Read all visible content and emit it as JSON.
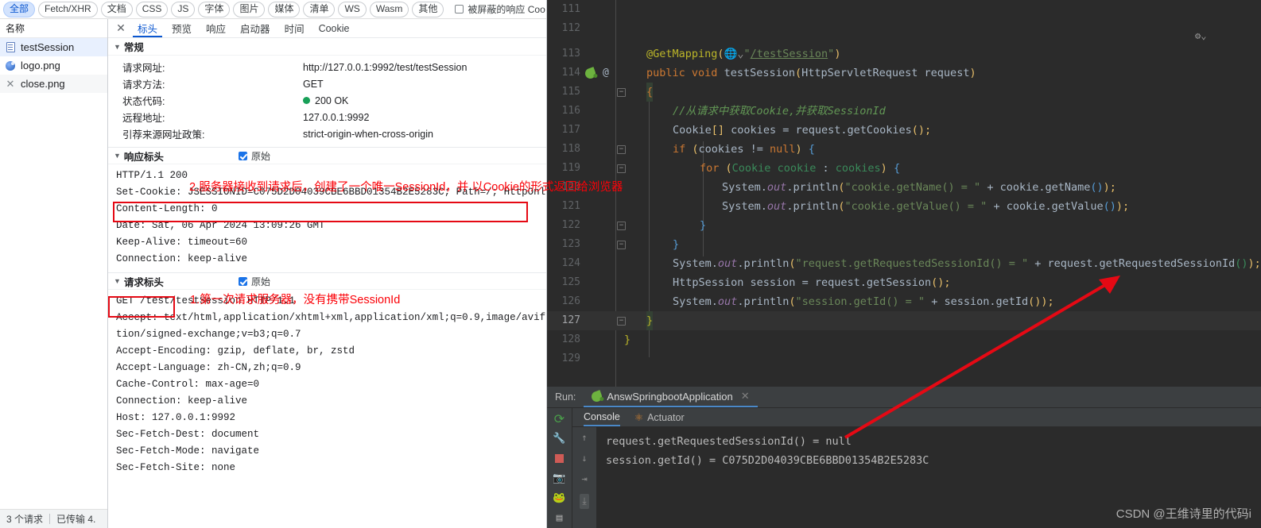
{
  "devtools": {
    "filter_bar": {
      "chips": [
        "全部",
        "Fetch/XHR",
        "文档",
        "CSS",
        "JS",
        "字体",
        "图片",
        "媒体",
        "清单",
        "WS",
        "Wasm",
        "其他"
      ],
      "active_chip": "全部",
      "blocked_label": "被屏蔽的响应 Coo"
    },
    "names_panel": {
      "header": "名称",
      "files": [
        {
          "name": "testSession",
          "icon": "document-icon"
        },
        {
          "name": "logo.png",
          "icon": "image-icon"
        },
        {
          "name": "close.png",
          "icon": "close-icon"
        }
      ],
      "footer": {
        "requests": "3 个请求",
        "transferred": "已传输 4."
      }
    },
    "detail_tabs": [
      "标头",
      "预览",
      "响应",
      "启动器",
      "时间",
      "Cookie"
    ],
    "detail_active_tab": "标头",
    "general": {
      "title": "常规",
      "rows": [
        {
          "key": "请求网址:",
          "value": "http://127.0.0.1:9992/test/testSession"
        },
        {
          "key": "请求方法:",
          "value": "GET"
        },
        {
          "key": "状态代码:",
          "value": "200 OK",
          "status_dot": "#18a058"
        },
        {
          "key": "远程地址:",
          "value": "127.0.0.1:9992"
        },
        {
          "key": "引荐来源网址政策:",
          "value": "strict-origin-when-cross-origin"
        }
      ]
    },
    "response_headers": {
      "title": "响应标头",
      "raw_label": "原始",
      "raw_checked": true,
      "lines": [
        "HTTP/1.1 200",
        "Set-Cookie: JSESSIONID=C075D2D04039CBE6BBD01354B2E5283C; Path=/; HttpOnly",
        "Content-Length: 0",
        "Date: Sat, 06 Apr 2024 13:09:26 GMT",
        "Keep-Alive: timeout=60",
        "Connection: keep-alive"
      ]
    },
    "request_headers": {
      "title": "请求标头",
      "raw_label": "原始",
      "raw_checked": true,
      "lines": [
        "GET /test/testSession HTTP/1.1",
        "Accept: text/html,application/xhtml+xml,application/xml;q=0.9,image/avif,im",
        "tion/signed-exchange;v=b3;q=0.7",
        "Accept-Encoding: gzip, deflate, br, zstd",
        "Accept-Language: zh-CN,zh;q=0.9",
        "Cache-Control: max-age=0",
        "Connection: keep-alive",
        "Host: 127.0.0.1:9992",
        "Sec-Fetch-Dest: document",
        "Sec-Fetch-Mode: navigate",
        "Sec-Fetch-Site: none"
      ]
    }
  },
  "annotations": {
    "note1": "1.第一次请求服务器，没有携带SessionId",
    "note2": "2.服务器接收到请求后，创建了一个唯一SessionId，并 以Cookie的形式返回给浏览器",
    "color": "#fb0007"
  },
  "ide": {
    "editor": {
      "first_line_number": 111,
      "current_line": 127,
      "lines": [
        {
          "n": 111,
          "text": ""
        },
        {
          "n": 112,
          "text": ""
        },
        {
          "n": 113,
          "text": "@GetMapping(\"/testSession\")"
        },
        {
          "n": 114,
          "text": "public void testSession(HttpServletRequest request)"
        },
        {
          "n": 115,
          "text": "{"
        },
        {
          "n": 116,
          "text": "    //从请求中获取Cookie,并获取SessionId"
        },
        {
          "n": 117,
          "text": "    Cookie[] cookies = request.getCookies();"
        },
        {
          "n": 118,
          "text": "    if (cookies != null) {"
        },
        {
          "n": 119,
          "text": "        for (Cookie cookie : cookies) {"
        },
        {
          "n": 120,
          "text": "            System.out.println(\"cookie.getName() = \" + cookie.getName());"
        },
        {
          "n": 121,
          "text": "            System.out.println(\"cookie.getValue() = \" + cookie.getValue());"
        },
        {
          "n": 122,
          "text": "        }"
        },
        {
          "n": 123,
          "text": "    }"
        },
        {
          "n": 124,
          "text": "    System.out.println(\"request.getRequestedSessionId() = \" + request.getRequestedSessionId());"
        },
        {
          "n": 125,
          "text": "    HttpSession session = request.getSession();"
        },
        {
          "n": 126,
          "text": "    System.out.println(\"session.getId() = \" + session.getId());"
        },
        {
          "n": 127,
          "text": "}"
        },
        {
          "n": 128,
          "text": "}"
        },
        {
          "n": 129,
          "text": ""
        }
      ]
    },
    "run_panel": {
      "run_label": "Run:",
      "tab_title": "AnswSpringbootApplication",
      "console_tabs": [
        "Console",
        "Actuator"
      ],
      "active_console_tab": "Console",
      "output": [
        "request.getRequestedSessionId() = null",
        "session.getId() = C075D2D04039CBE6BBD01354B2E5283C"
      ]
    },
    "watermark": "CSDN @王维诗里的代码i"
  }
}
